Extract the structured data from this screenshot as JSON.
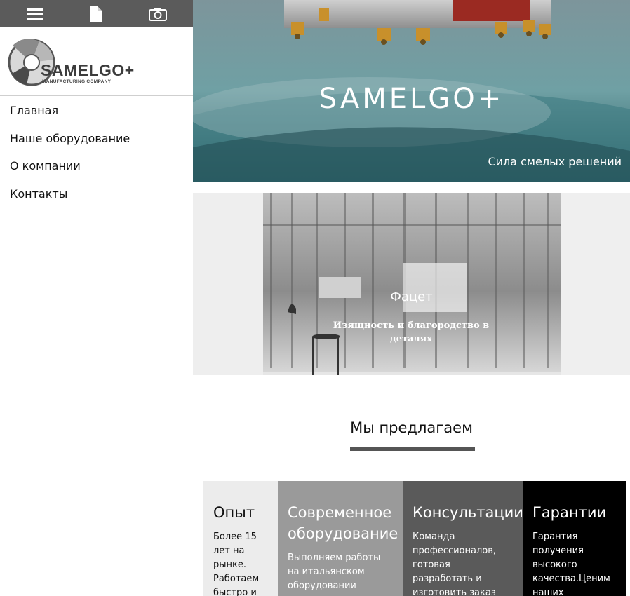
{
  "toolbar": {
    "icons": [
      "menu-icon",
      "document-icon",
      "camera-icon"
    ]
  },
  "logo": {
    "name": "SAMELGO+",
    "subtitle": "MANUFACTURING COMPANY"
  },
  "nav": {
    "items": [
      {
        "label": "Главная"
      },
      {
        "label": "Наше оборудование"
      },
      {
        "label": "О компании"
      },
      {
        "label": "Контакты"
      }
    ]
  },
  "hero": {
    "title": "SAMELGO+",
    "tagline": "Сила смелых решений"
  },
  "banner": {
    "title": "Фацет",
    "subtitle": "Изящность и благородство в деталях"
  },
  "offer": {
    "title": "Мы предлагаем"
  },
  "cards": [
    {
      "title": "Опыт",
      "text": "Более 15 лет на рынке. Работаем быстро и"
    },
    {
      "title": "Современное оборудование",
      "text": "Выполняем работы на итальянском оборудовании"
    },
    {
      "title": "Консультации",
      "text": "Команда профессионалов, готовая разработать и изготовить заказ"
    },
    {
      "title": "Гарантии",
      "text": "Гарантия получения высокого качества.Ценим наших"
    }
  ],
  "colors": {
    "topbar": "#5b5b5b",
    "accent_line": "#555555",
    "card_1": "#ececec",
    "card_2": "#9a9a9a",
    "card_3": "#5a5a5a",
    "card_4": "#000000"
  }
}
